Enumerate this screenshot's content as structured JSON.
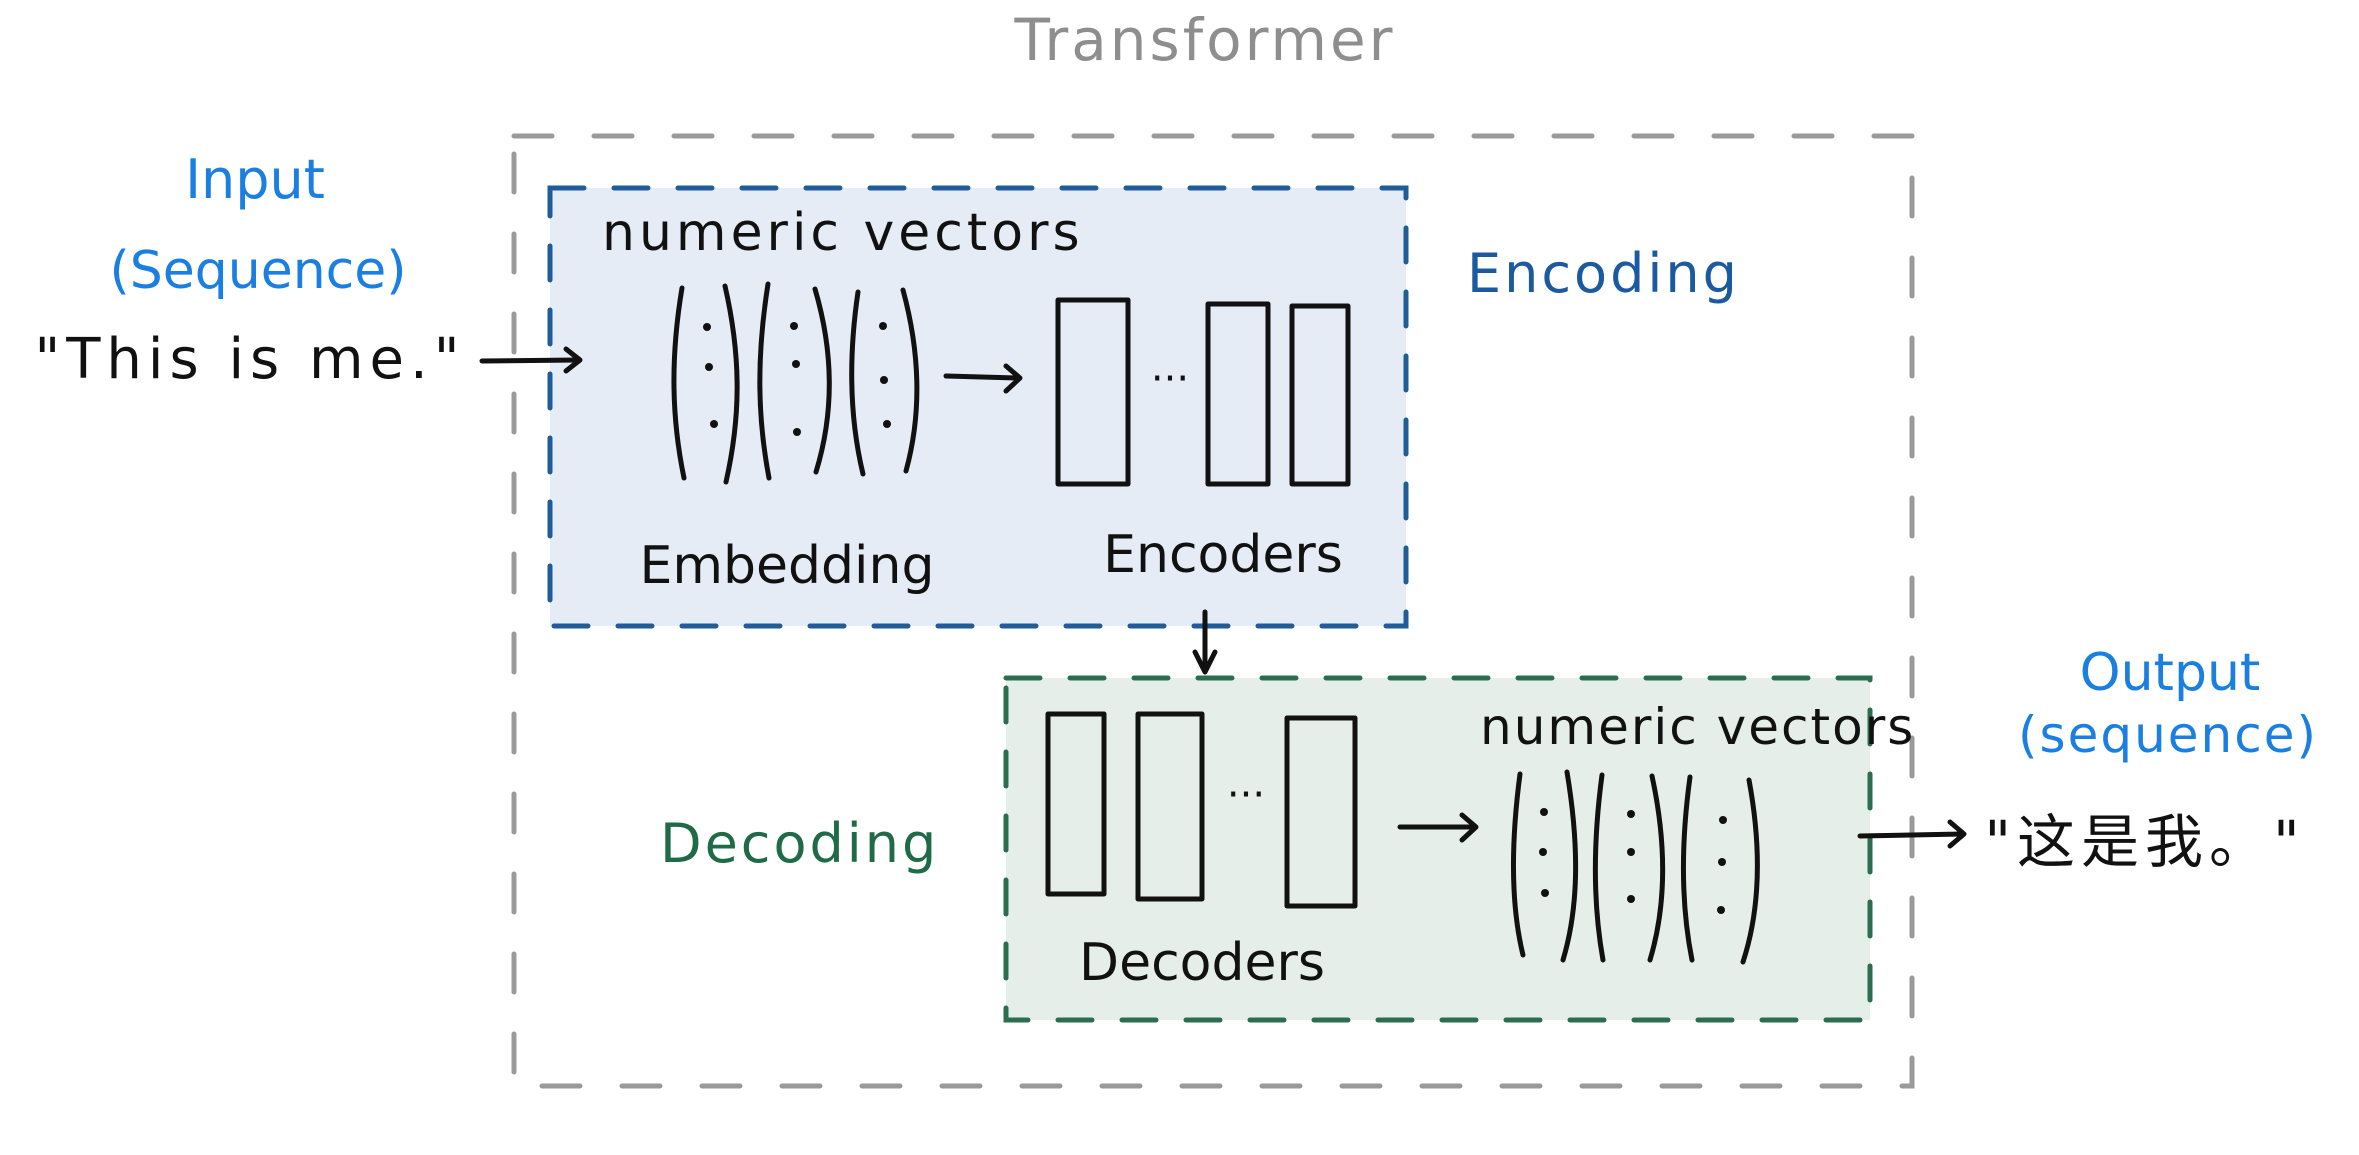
{
  "title": "Transformer",
  "input": {
    "label": "Input",
    "sublabel": "(Sequence)",
    "text": "\"This is me.\""
  },
  "encoding": {
    "section_label": "Encoding",
    "vectors_label": "numeric vectors",
    "embedding_label": "Embedding",
    "encoders_label": "Encoders",
    "ellipsis": "···"
  },
  "decoding": {
    "section_label": "Decoding",
    "decoders_label": "Decoders",
    "vectors_label": "numeric vectors",
    "ellipsis": "···"
  },
  "output": {
    "label": "Output",
    "sublabel": "(sequence)",
    "text": "\"这是我。\""
  },
  "colors": {
    "outer_border": "#9a9a9a",
    "encoding_fill": "#e5ecf5",
    "encoding_border": "#1f5c99",
    "decoding_fill": "#e6eeea",
    "decoding_border": "#2a6e4f",
    "io_label": "#1a7fe0",
    "encoding_label": "#1b5aa0",
    "decoding_label": "#1f6b47",
    "title": "#8e8e8e",
    "ink": "#111111"
  }
}
